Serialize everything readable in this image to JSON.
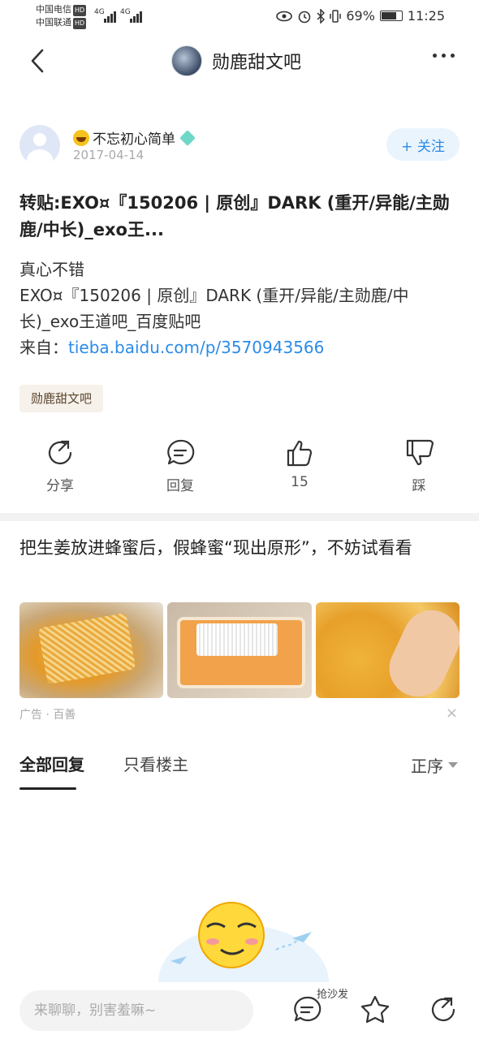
{
  "status": {
    "carrier1": "中国电信",
    "carrier2": "中国联通",
    "hd": "HD",
    "net1": "4G",
    "net2": "4G",
    "battery": "69%",
    "time": "11:25"
  },
  "header": {
    "title": "勋鹿甜文吧"
  },
  "post": {
    "author": "不忘初心简单",
    "date": "2017-04-14",
    "follow_label": "+ 关注",
    "title": "转贴:EXO¤『150206 | 原创』DARK (重开/异能/主勋鹿/中长)_exo王...",
    "body_line1": "真心不错",
    "body_line2": "EXO¤『150206 | 原创』DARK (重开/异能/主勋鹿/中长)_exo王道吧_百度贴吧",
    "from_label": "来自：",
    "link": "tieba.baidu.com/p/3570943566",
    "tag": "勋鹿甜文吧"
  },
  "actions": {
    "share": "分享",
    "reply": "回复",
    "like_count": "15",
    "dislike": "踩"
  },
  "ad": {
    "title": "把生姜放进蜂蜜后，假蜂蜜“现出原形”，不妨试看看",
    "source": "广告 · 百善",
    "close": "×"
  },
  "replies": {
    "tab_all": "全部回复",
    "tab_op": "只看楼主",
    "sort": "正序"
  },
  "bottom": {
    "input_placeholder": "来聊聊，别害羞嘛~",
    "sofa": "抢沙发"
  }
}
